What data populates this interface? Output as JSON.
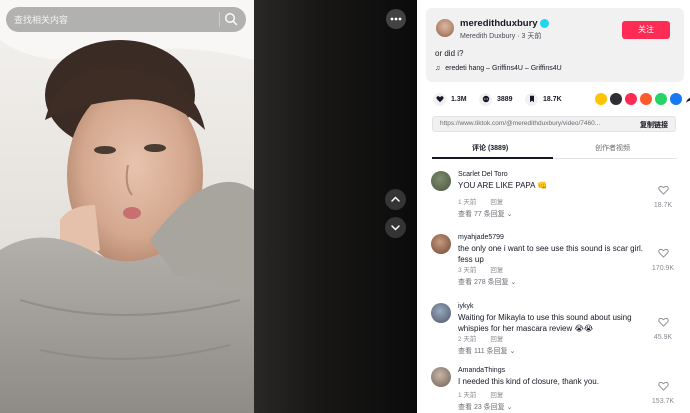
{
  "search": {
    "placeholder": "查找相关内容"
  },
  "author": {
    "username": "meredithduxbury",
    "display_name": "Meredith Duxbury",
    "time": "3 天前",
    "follow_label": "关注",
    "description": "or did i?",
    "music": "eredeti hang – Griffins4U – Griffins4U"
  },
  "stats": {
    "likes": "1.3M",
    "comments": "3889",
    "saves": "18.7K"
  },
  "link": {
    "url": "https://www.tiktok.com/@meredithduxbury/video/7460...",
    "copy_label": "复制链接"
  },
  "tabs": {
    "comments": "评论 (3889)",
    "creator_videos": "创作者视频"
  },
  "comments": [
    {
      "user": "Scarlet Del Toro",
      "text": "YOU ARE LIKE PAPA 👊",
      "time": "1 天前",
      "reply": "回复",
      "replies": "查看 77 条回复",
      "likes": "18.7K",
      "avatar_color": "#5f6b55"
    },
    {
      "user": "myahjade5799",
      "text": "the only one i want to see use this sound is scar girl. fess up",
      "time": "3 天前",
      "reply": "回复",
      "replies": "查看 278 条回复",
      "likes": "170.9K",
      "avatar_color": "#8a5a45"
    },
    {
      "user": "iykyk",
      "text": "Waiting for Mikayla to use this sound about using whispies for her mascara review 😭😭",
      "time": "2 天前",
      "reply": "回复",
      "replies": "查看 111 条回复",
      "likes": "45.9K",
      "avatar_color": "#6c7a8e"
    },
    {
      "user": "AmandaThings",
      "text": "I needed this kind of closure, thank you.",
      "time": "1 天前",
      "reply": "回复",
      "replies": "查看 23 条回复",
      "likes": "153.7K",
      "avatar_color": "#9a8a7e"
    }
  ],
  "colors": {
    "accent": "#fe2c55",
    "verified": "#20d5ec"
  }
}
